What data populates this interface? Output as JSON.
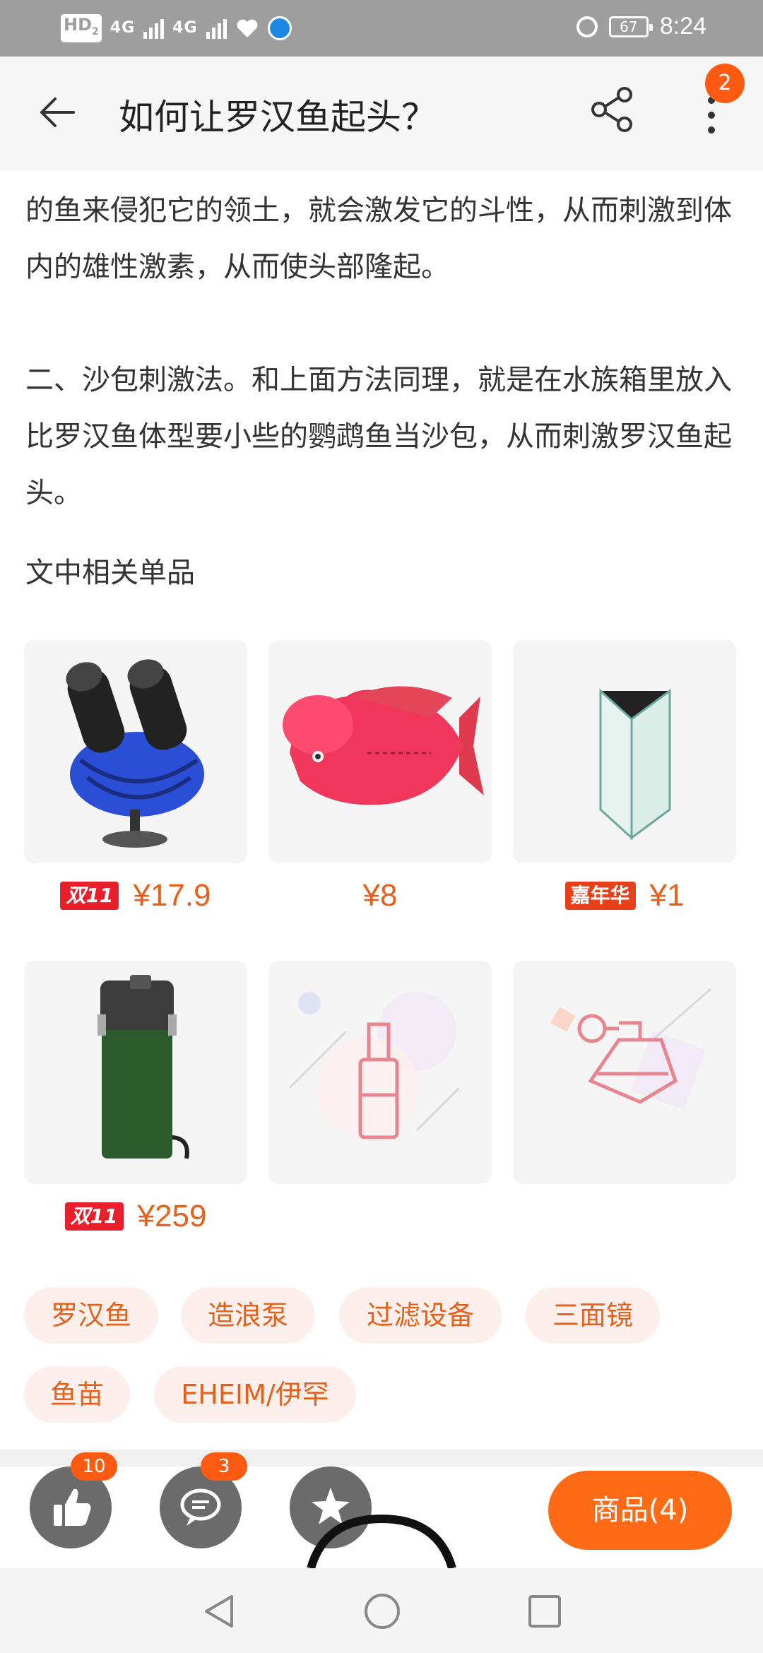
{
  "status_bar": {
    "hd": "HD",
    "hd_sub": "2",
    "signal1": "4G",
    "signal2": "4G",
    "battery": "67",
    "time": "8:24"
  },
  "header": {
    "title": "如何让罗汉鱼起头？",
    "more_badge": "2"
  },
  "article": {
    "paragraph1": "的鱼来侵犯它的领土，就会激发它的斗性，从而刺激到体内的雄性激素，从而使头部隆起。",
    "paragraph2": "二、沙包刺激法。和上面方法同理，就是在水族箱里放入比罗汉鱼体型要小些的鹦鹉鱼当沙包，从而刺激罗汉鱼起头。"
  },
  "related": {
    "title": "文中相关单品",
    "products": [
      {
        "image": "wave-pump",
        "tag": "双11",
        "price": "¥17.9"
      },
      {
        "image": "flowerhorn-fish",
        "tag": "",
        "price": "¥8"
      },
      {
        "image": "triangle-glass-tank",
        "tag": "嘉年华",
        "price": "¥1"
      },
      {
        "image": "canister-filter",
        "tag": "双11",
        "price": "¥259"
      },
      {
        "image": "placeholder-bottle",
        "tag": "",
        "price": ""
      },
      {
        "image": "placeholder-perfume",
        "tag": "",
        "price": ""
      }
    ]
  },
  "tags": [
    "罗汉鱼",
    "造浪泵",
    "过滤设备",
    "三面镜",
    "鱼苗",
    "EHEIM/伊罕"
  ],
  "actions": {
    "like_count": "10",
    "comment_count": "3",
    "goods_label": "商品(4)"
  },
  "colors": {
    "accent": "#ff6a14",
    "price": "#e5601a",
    "chip_bg": "#fdf0ec",
    "status_bar": "#9e9e9e"
  }
}
